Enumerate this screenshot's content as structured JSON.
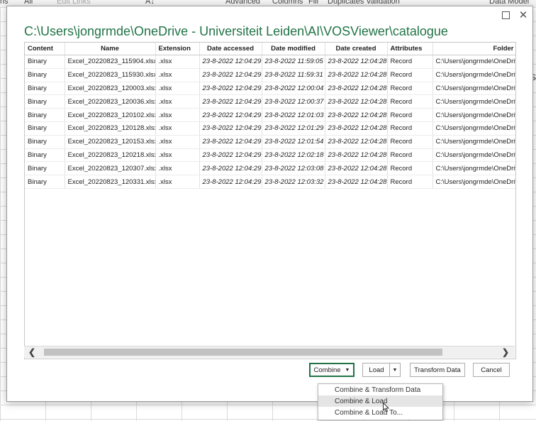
{
  "background": {
    "ribbon_items": [
      "ns",
      "All",
      "Edit Links",
      "A↓",
      "Advanced",
      "Columns",
      "Fill",
      "Duplicates Validation",
      "Data Model"
    ],
    "side_letter": "S"
  },
  "dialog": {
    "title": "C:\\Users\\jongrmde\\OneDrive - Universiteit Leiden\\AI\\VOSViewer\\catalogue"
  },
  "table": {
    "columns": [
      "Content",
      "Name",
      "Extension",
      "Date accessed",
      "Date modified",
      "Date created",
      "Attributes",
      "Folder"
    ],
    "rows": [
      [
        "Binary",
        "Excel_20220823_115904.xlsx",
        ".xlsx",
        "23-8-2022 12:04:29",
        "23-8-2022 11:59:05",
        "23-8-2022 12:04:28",
        "Record",
        "C:\\Users\\jongrmde\\OneDriv"
      ],
      [
        "Binary",
        "Excel_20220823_115930.xlsx",
        ".xlsx",
        "23-8-2022 12:04:29",
        "23-8-2022 11:59:31",
        "23-8-2022 12:04:28",
        "Record",
        "C:\\Users\\jongrmde\\OneDriv"
      ],
      [
        "Binary",
        "Excel_20220823_120003.xlsx",
        ".xlsx",
        "23-8-2022 12:04:29",
        "23-8-2022 12:00:04",
        "23-8-2022 12:04:28",
        "Record",
        "C:\\Users\\jongrmde\\OneDriv"
      ],
      [
        "Binary",
        "Excel_20220823_120036.xlsx",
        ".xlsx",
        "23-8-2022 12:04:29",
        "23-8-2022 12:00:37",
        "23-8-2022 12:04:28",
        "Record",
        "C:\\Users\\jongrmde\\OneDriv"
      ],
      [
        "Binary",
        "Excel_20220823_120102.xlsx",
        ".xlsx",
        "23-8-2022 12:04:29",
        "23-8-2022 12:01:03",
        "23-8-2022 12:04:28",
        "Record",
        "C:\\Users\\jongrmde\\OneDriv"
      ],
      [
        "Binary",
        "Excel_20220823_120128.xlsx",
        ".xlsx",
        "23-8-2022 12:04:29",
        "23-8-2022 12:01:29",
        "23-8-2022 12:04:28",
        "Record",
        "C:\\Users\\jongrmde\\OneDriv"
      ],
      [
        "Binary",
        "Excel_20220823_120153.xlsx",
        ".xlsx",
        "23-8-2022 12:04:29",
        "23-8-2022 12:01:54",
        "23-8-2022 12:04:28",
        "Record",
        "C:\\Users\\jongrmde\\OneDriv"
      ],
      [
        "Binary",
        "Excel_20220823_120218.xlsx",
        ".xlsx",
        "23-8-2022 12:04:29",
        "23-8-2022 12:02:18",
        "23-8-2022 12:04:28",
        "Record",
        "C:\\Users\\jongrmde\\OneDriv"
      ],
      [
        "Binary",
        "Excel_20220823_120307.xlsx",
        ".xlsx",
        "23-8-2022 12:04:29",
        "23-8-2022 12:03:08",
        "23-8-2022 12:04:28",
        "Record",
        "C:\\Users\\jongrmde\\OneDriv"
      ],
      [
        "Binary",
        "Excel_20220823_120331.xlsx",
        ".xlsx",
        "23-8-2022 12:04:29",
        "23-8-2022 12:03:32",
        "23-8-2022 12:04:28",
        "Record",
        "C:\\Users\\jongrmde\\OneDriv"
      ]
    ]
  },
  "buttons": {
    "combine": "Combine",
    "load": "Load",
    "transform": "Transform Data",
    "cancel": "Cancel"
  },
  "menu": {
    "items": [
      "Combine & Transform Data",
      "Combine & Load",
      "Combine & Load To..."
    ],
    "hovered_index": 1
  },
  "icons": {
    "maximize": "maximize-icon",
    "close": "close-icon",
    "scroll_left": "chevron-left-icon",
    "scroll_right": "chevron-right-icon",
    "dropdown": "caret-down-icon"
  },
  "colors": {
    "title": "#217346",
    "combine_border": "#217346",
    "menu_hover": "#e5e5e5"
  }
}
